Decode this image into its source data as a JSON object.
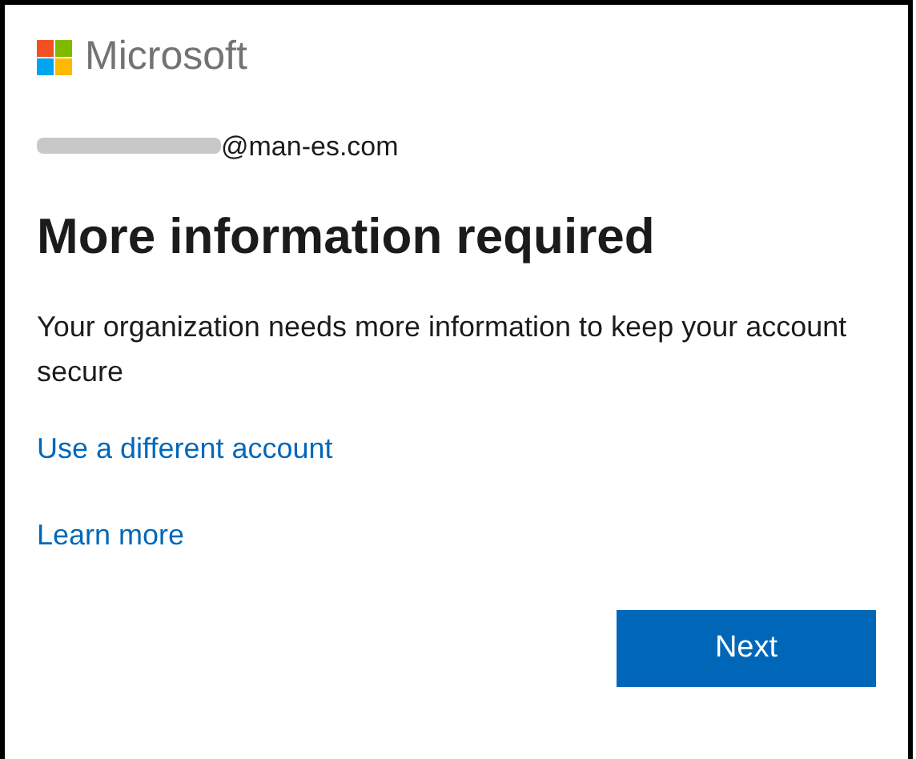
{
  "brand": {
    "name": "Microsoft"
  },
  "account": {
    "email_visible": "@man-es.com"
  },
  "title": "More information required",
  "message": "Your organization needs more information to keep your account secure",
  "links": [
    "Use a different account",
    "Learn more"
  ],
  "buttons": [
    "Next"
  ]
}
